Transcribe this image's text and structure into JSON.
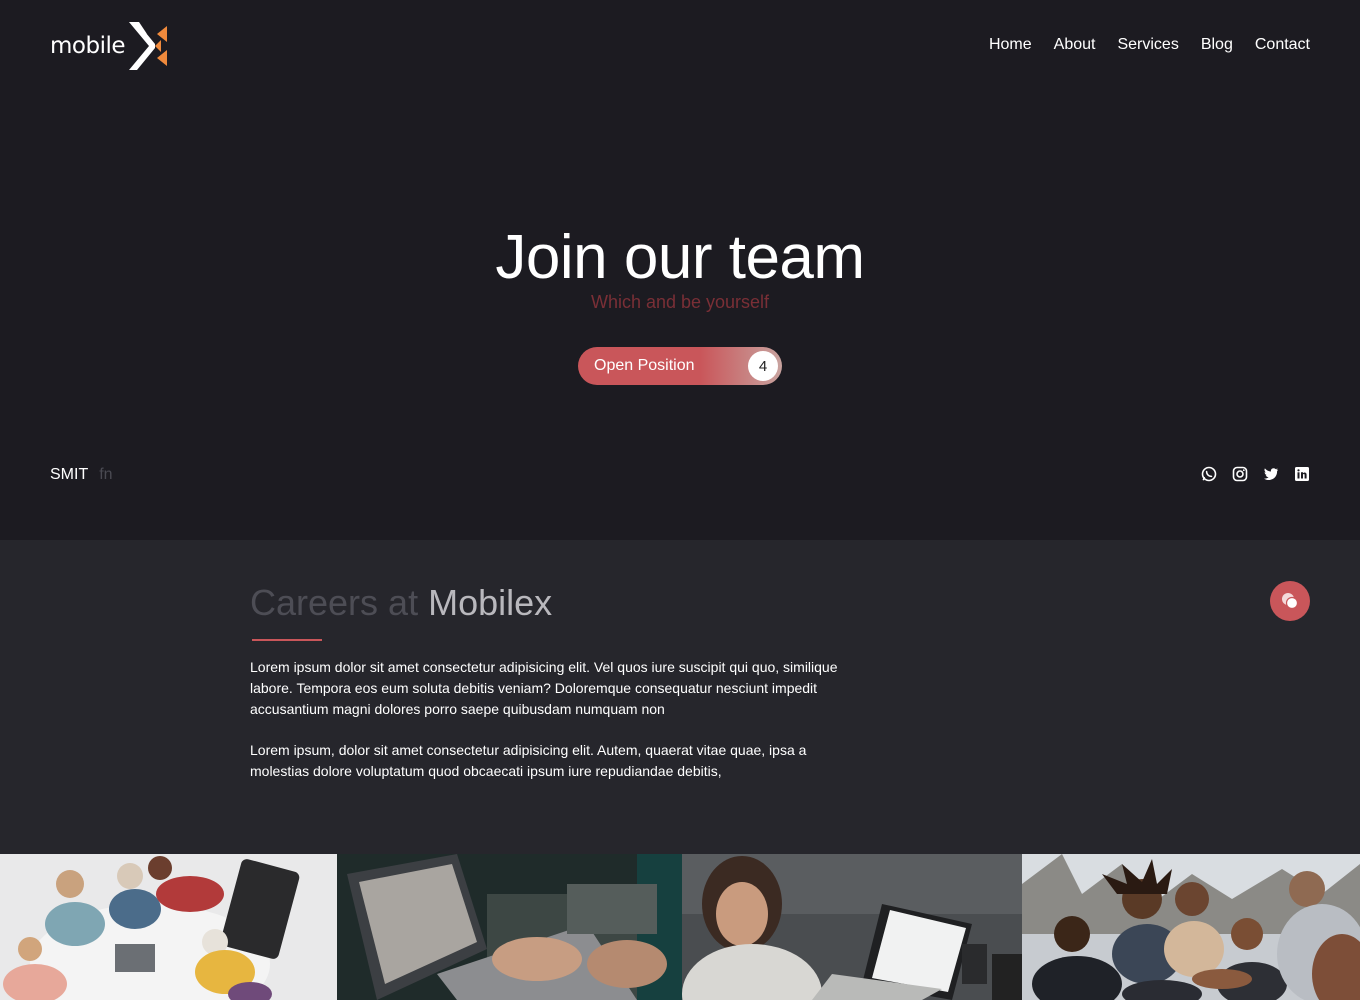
{
  "header": {
    "logo_text": "mobile",
    "nav": [
      {
        "label": "Home"
      },
      {
        "label": "About"
      },
      {
        "label": "Services"
      },
      {
        "label": "Blog"
      },
      {
        "label": "Contact"
      }
    ]
  },
  "hero": {
    "title": "Join our team",
    "subtitle": "Which and be yourself",
    "button_label": "Open Position",
    "button_count": "4",
    "footer_left": "SMIT",
    "footer_left_muted": "fn",
    "socials": [
      "whatsapp-icon",
      "instagram-icon",
      "twitter-icon",
      "linkedin-icon"
    ]
  },
  "careers": {
    "title_muted": "Careers at",
    "title_bright": "Mobilex",
    "paragraphs": [
      "Lorem ipsum dolor sit amet consectetur adipisicing elit. Vel quos iure suscipit qui quo, similique labore. Tempora eos eum soluta debitis veniam? Doloremque consequatur nesciunt impedit accusantium magni dolores porro saepe quibusdam numquam non",
      "Lorem ipsum, dolor sit amet consectetur adipisicing elit. Autem, quaerat vitae quae, ipsa a molestias dolore voluptatum quod obcaecati ipsum iure repudiandae debitis,"
    ]
  },
  "gallery": [
    "team-meeting-photo",
    "laptop-typing-photo",
    "woman-laptop-photo",
    "team-celebration-photo"
  ],
  "colors": {
    "background": "#1c1b21",
    "section_background": "#26262c",
    "accent": "#c9565a",
    "logo_orange": "#f08a3c"
  }
}
